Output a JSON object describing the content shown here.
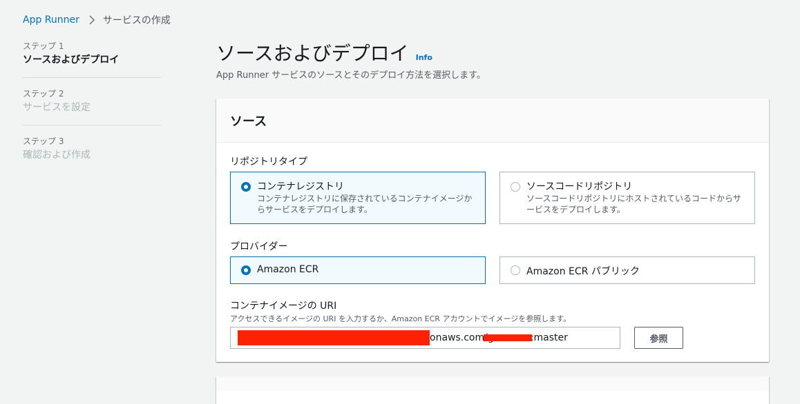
{
  "breadcrumb": {
    "root": "App Runner",
    "current": "サービスの作成"
  },
  "steps": [
    {
      "label": "ステップ 1",
      "title": "ソースおよびデプロイ",
      "active": true
    },
    {
      "label": "ステップ 2",
      "title": "サービスを設定",
      "active": false
    },
    {
      "label": "ステップ 3",
      "title": "確認および作成",
      "active": false
    }
  ],
  "header": {
    "title": "ソースおよびデプロイ",
    "info": "Info",
    "description": "App Runner サービスのソースとそのデプロイ方法を選択します。"
  },
  "source_panel": {
    "title": "ソース",
    "repository_type": {
      "label": "リポジトリタイプ",
      "options": [
        {
          "title": "コンテナレジストリ",
          "desc": "コンテナレジストリに保存されているコンテナイメージからサービスをデプロイします。",
          "selected": true
        },
        {
          "title": "ソースコードリポジトリ",
          "desc": "ソースコードリポジトリにホストされているコードからサービスをデプロイします。",
          "selected": false
        }
      ]
    },
    "provider": {
      "label": "プロバイダー",
      "options": [
        {
          "title": "Amazon ECR",
          "selected": true
        },
        {
          "title": "Amazon ECR パブリック",
          "selected": false
        }
      ]
    },
    "image_uri": {
      "label": "コンテナイメージの URI",
      "description": "アクセスできるイメージの URI を入力するか、Amazon ECR アカウントでイメージを参照します。",
      "value": "onaws.com/ge          :master",
      "browse_label": "参照"
    }
  },
  "colors": {
    "link": "#0073bb",
    "selected_border": "#0073bb",
    "selected_bg": "#f1faff",
    "redaction": "#ff2200"
  }
}
